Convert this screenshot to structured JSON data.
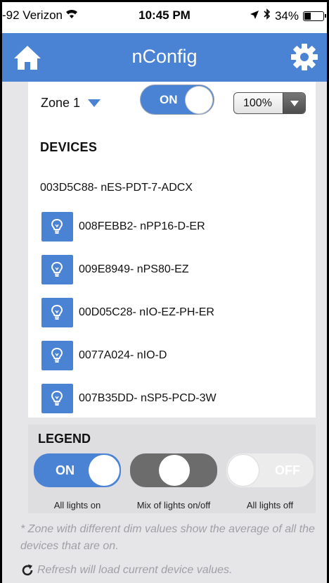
{
  "status_bar": {
    "carrier": "-92 Verizon",
    "time": "10:45 PM",
    "battery": "34%",
    "battery_level": 0.34
  },
  "nav": {
    "title": "nConfig",
    "home_icon": "home-icon",
    "settings_icon": "gear-icon"
  },
  "zone": {
    "label": "Zone 1",
    "toggle_label": "ON",
    "dim_value": "100%"
  },
  "devices": {
    "heading": "DEVICES",
    "master": "003D5C88- nES-PDT-7-ADCX",
    "items": [
      {
        "name": "008FEBB2- nPP16-D-ER"
      },
      {
        "name": "009E8949- nPS80-EZ"
      },
      {
        "name": "00D05C28- nIO-EZ-PH-ER"
      },
      {
        "name": "0077A024- nIO-D"
      },
      {
        "name": "007B35DD- nSP5-PCD-3W"
      }
    ]
  },
  "legend": {
    "title": "LEGEND",
    "on_label": "ON",
    "off_label": "OFF",
    "captions": {
      "on": "All lights on",
      "mix": "Mix of lights on/off",
      "off": "All lights off"
    }
  },
  "footnote": {
    "dim_note": "* Zone with different dim values show the average of all the devices that are on.",
    "refresh_note": "Refresh will load current device values."
  },
  "colors": {
    "accent": "#4a83d4",
    "mix": "#6c6c6c",
    "off": "#ececec",
    "note_text": "#a0a0a5"
  }
}
